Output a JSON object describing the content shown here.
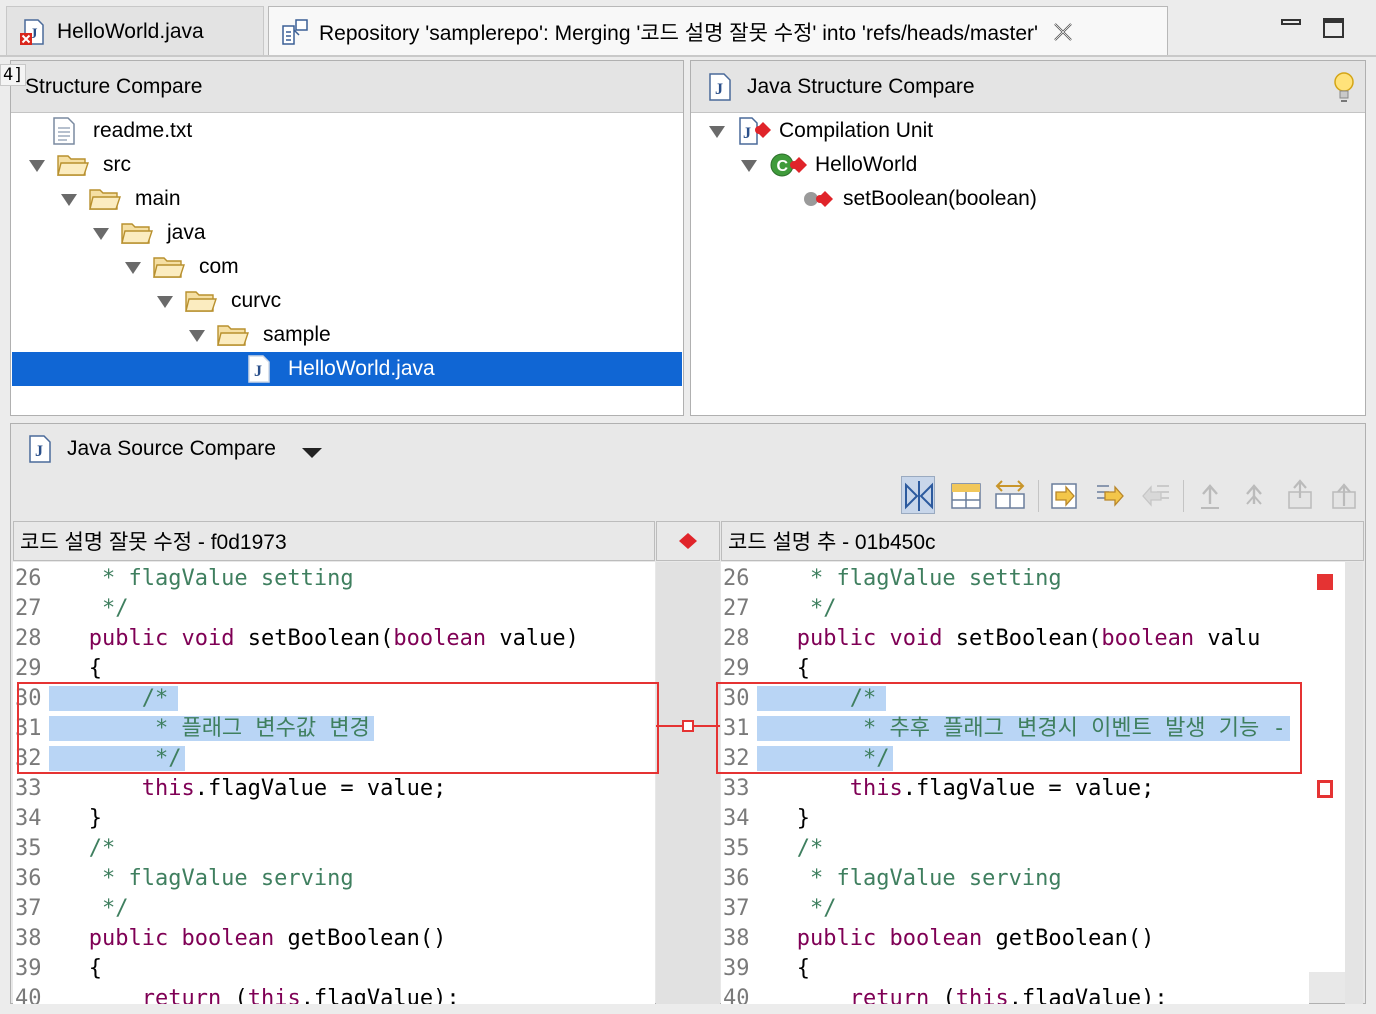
{
  "tabs": [
    {
      "label": "HelloWorld.java",
      "icon": "java-file-error-icon"
    },
    {
      "label": "Repository 'samplerepo': Merging '코드 설명 잘못 수정' into 'refs/heads/master'",
      "icon": "compare-icon"
    }
  ],
  "structure_compare": {
    "title": "Structure Compare",
    "gutter": "4]",
    "items": [
      {
        "label": "readme.txt",
        "icon": "text-file-icon",
        "depth": 1,
        "expanded": null
      },
      {
        "label": "src",
        "icon": "folder-icon",
        "depth": 0,
        "expanded": true
      },
      {
        "label": "main",
        "icon": "folder-icon",
        "depth": 1,
        "expanded": true
      },
      {
        "label": "java",
        "icon": "folder-icon",
        "depth": 2,
        "expanded": true
      },
      {
        "label": "com",
        "icon": "folder-icon",
        "depth": 3,
        "expanded": true
      },
      {
        "label": "curvc",
        "icon": "folder-icon",
        "depth": 4,
        "expanded": true
      },
      {
        "label": "sample",
        "icon": "folder-icon",
        "depth": 5,
        "expanded": true
      },
      {
        "label": "HelloWorld.java",
        "icon": "java-file-icon",
        "depth": 7,
        "expanded": null,
        "selected": true
      }
    ]
  },
  "java_structure_compare": {
    "title": "Java Structure Compare",
    "items": [
      {
        "label": "Compilation Unit",
        "icon": "compilation-unit-icon"
      },
      {
        "label": "HelloWorld",
        "icon": "class-icon"
      },
      {
        "label": "setBoolean(boolean)",
        "icon": "method-icon"
      }
    ]
  },
  "java_source_compare": {
    "title": "Java Source Compare",
    "left_title": "코드 설명 잘못 수정 - f0d1973",
    "right_title": "코드 설명 추 - 01b450c",
    "left_lines": [
      {
        "n": "26",
        "t": "    * flagValue setting"
      },
      {
        "n": "27",
        "t": "    */"
      },
      {
        "n": "28",
        "t": "   public void setBoolean(boolean value)"
      },
      {
        "n": "29",
        "t": "   {"
      },
      {
        "n": "30",
        "t": "       /*"
      },
      {
        "n": "31",
        "t": "        * 플래그 변수값 변경"
      },
      {
        "n": "32",
        "t": "        */"
      },
      {
        "n": "33",
        "t": "       this.flagValue = value;"
      },
      {
        "n": "34",
        "t": "   }"
      },
      {
        "n": "35",
        "t": "   /*"
      },
      {
        "n": "36",
        "t": "    * flagValue serving"
      },
      {
        "n": "37",
        "t": "    */"
      },
      {
        "n": "38",
        "t": "   public boolean getBoolean()"
      },
      {
        "n": "39",
        "t": "   {"
      },
      {
        "n": "40",
        "t": "       return (this.flagValue);"
      }
    ],
    "right_lines": [
      {
        "n": "26",
        "t": "    * flagValue setting"
      },
      {
        "n": "27",
        "t": "    */"
      },
      {
        "n": "28",
        "t": "   public void setBoolean(boolean valu"
      },
      {
        "n": "29",
        "t": "   {"
      },
      {
        "n": "30",
        "t": "       /*"
      },
      {
        "n": "31",
        "t": "        * 추후 플래그 변경시 이벤트 발생 기능 -"
      },
      {
        "n": "32",
        "t": "        */"
      },
      {
        "n": "33",
        "t": "       this.flagValue = value;"
      },
      {
        "n": "34",
        "t": "   }"
      },
      {
        "n": "35",
        "t": "   /*"
      },
      {
        "n": "36",
        "t": "    * flagValue serving"
      },
      {
        "n": "37",
        "t": "    */"
      },
      {
        "n": "38",
        "t": "   public boolean getBoolean()"
      },
      {
        "n": "39",
        "t": "   {"
      },
      {
        "n": "40",
        "t": "       return (this.flagValue);"
      }
    ]
  },
  "colors": {
    "selection": "#1066d4",
    "diff_border": "#e53333",
    "diff_highlight": "#b9d5f5",
    "keyword": "#7f0055",
    "comment": "#3f7f5f"
  }
}
